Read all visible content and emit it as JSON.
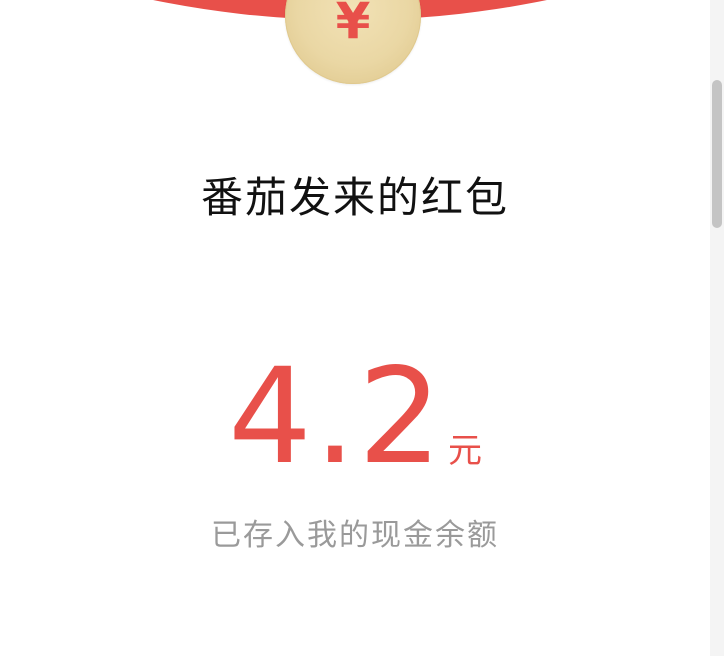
{
  "envelope": {
    "coin_symbol": "¥",
    "title": "番茄发来的红包",
    "amount": "4.2",
    "unit": "元",
    "status": "已存入我的现金余额"
  },
  "colors": {
    "red": "#e8504a",
    "coin": "#ead7a4",
    "subtitle": "#9a9a9a"
  }
}
